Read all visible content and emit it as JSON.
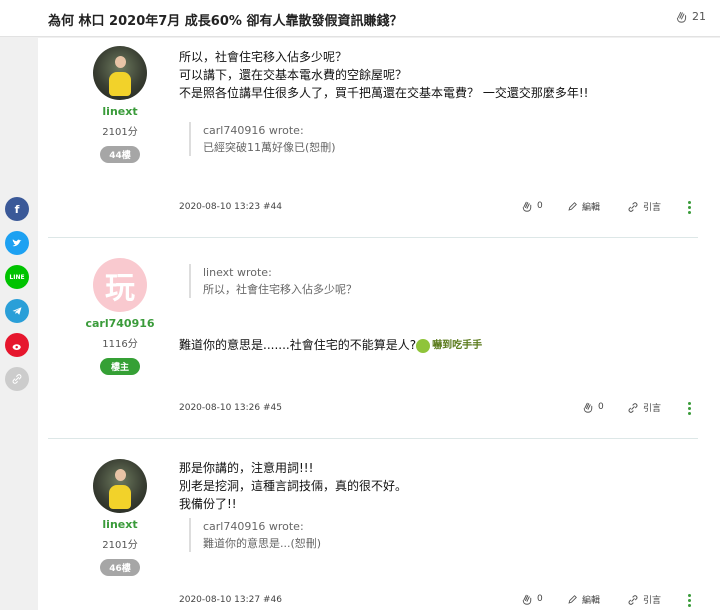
{
  "header": {
    "title": "為何 林口 2020年7月 成長60% 卻有人靠散發假資訊賺錢？",
    "likes": "21",
    "like_icon": "clap-icon"
  },
  "social": [
    "facebook-icon",
    "twitter-icon",
    "line-icon",
    "telegram-icon",
    "weibo-icon",
    "link-icon"
  ],
  "social_labels": {
    "facebook": "f",
    "line": "LINE"
  },
  "colors": {
    "username": "#3a9b3a",
    "owner_badge": "#35a035",
    "floor_badge": "#a6a6a6"
  },
  "posts": [
    {
      "author": {
        "name": "linext",
        "points": "2101分",
        "badge": "44樓"
      },
      "lines": [
        "所以，社會住宅移入佔多少呢？",
        "可以講下，還在交基本電水費的空餘屋呢？",
        "不是照各位講早住很多人了，買千把萬還在交基本電費？ 一交還交那麼多年!!"
      ],
      "quote": {
        "header": "carl740916 wrote:",
        "text": "已經突破11萬好像已(恕刪)"
      },
      "meta": "2020-08-10 13:23 #44",
      "actions": {
        "clap": "0",
        "edit": "編輯",
        "quote": "引言"
      }
    },
    {
      "author": {
        "name": "carl740916",
        "points": "1116分",
        "badge": "樓主",
        "avatar_char": "玩"
      },
      "quote": {
        "header": "linext wrote:",
        "text": "所以，社會住宅移入佔多少呢？"
      },
      "lines": [
        "難道你的意思是.......社會住宅的不能算是人?"
      ],
      "sticker": "嚇到吃手手",
      "meta": "2020-08-10 13:26 #45",
      "actions": {
        "clap": "0",
        "quote": "引言"
      }
    },
    {
      "author": {
        "name": "linext",
        "points": "2101分",
        "badge": "46樓"
      },
      "lines": [
        "那是你講的，注意用詞!!!",
        "別老是挖洞，這種言詞技倆，真的很不好。",
        "我備份了!!"
      ],
      "quote": {
        "header": "carl740916 wrote:",
        "text": "難道你的意思是...(恕刪)"
      },
      "meta": "2020-08-10 13:27 #46",
      "actions": {
        "clap": "0",
        "edit": "編輯",
        "quote": "引言"
      }
    }
  ]
}
